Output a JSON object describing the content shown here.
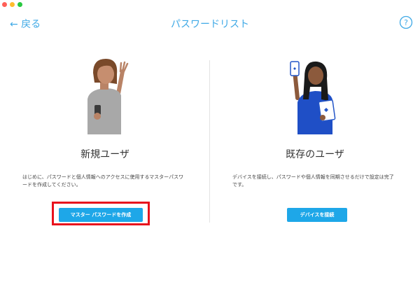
{
  "window": {
    "traffic_lights": [
      "#ff5f57",
      "#febc2e",
      "#28c840"
    ]
  },
  "header": {
    "back_label": "← 戻る",
    "title": "パスワードリスト",
    "help_label": "?",
    "accent_color": "#3fa9e6"
  },
  "panels": [
    {
      "title": "新規ユーザ",
      "description": "はじめに、パスワードと個人情報へのアクセスに使用するマスターパスワードを作成してください。",
      "button_label": "マスター パスワードを作成",
      "illustration": "person-waving-with-phone"
    },
    {
      "title": "既存のユーザ",
      "description": "デバイスを接続し、パスワードや個人情報を同期させるだけで設定は完了です。",
      "button_label": "デバイスを接続",
      "illustration": "person-with-phone-and-tablet"
    }
  ],
  "colors": {
    "button": "#1ea7e8",
    "highlight": "#e8121d"
  }
}
